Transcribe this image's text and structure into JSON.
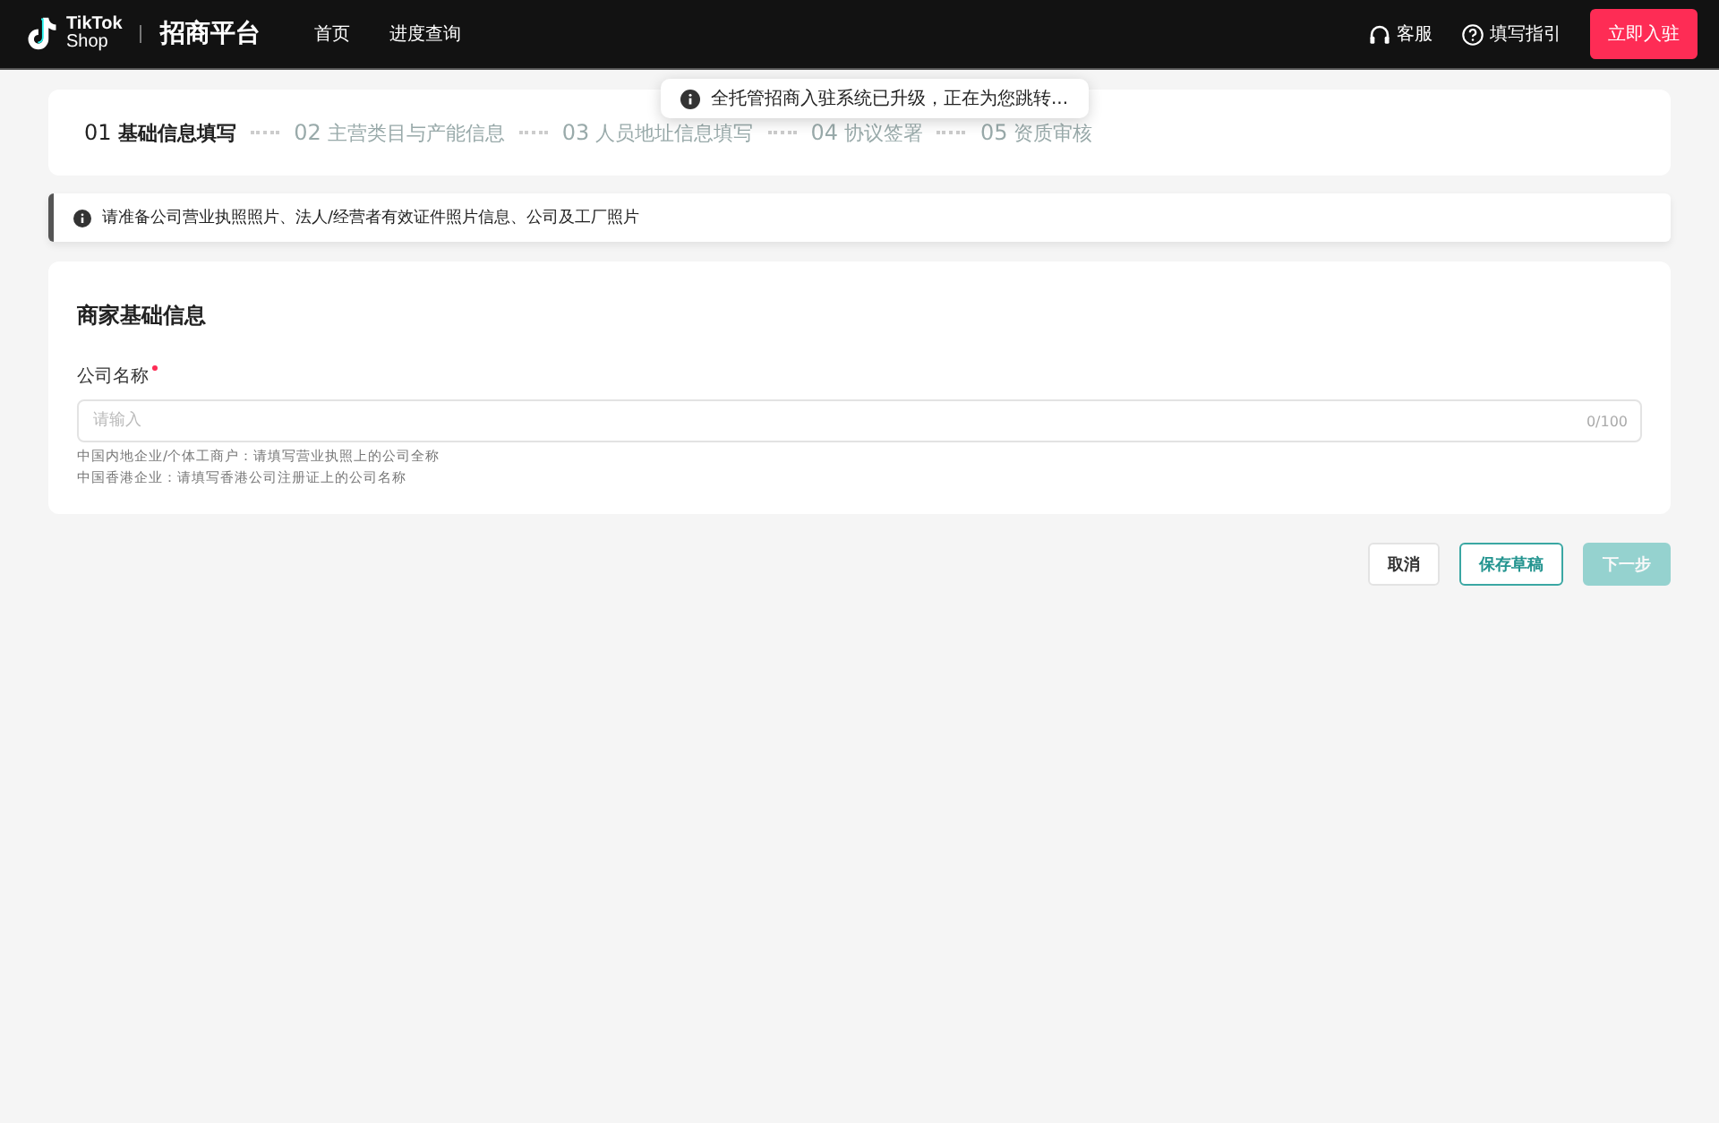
{
  "header": {
    "logo_line1": "TikTok",
    "logo_line2": "Shop",
    "platform": "招商平台",
    "nav": [
      {
        "label": "首页"
      },
      {
        "label": "进度查询"
      }
    ],
    "links": [
      {
        "kind": "support",
        "label": "客服"
      },
      {
        "kind": "help",
        "label": "填写指引"
      }
    ],
    "cta": "立即入驻"
  },
  "steps": [
    {
      "number": "01",
      "label": "基础信息填写",
      "selected": true
    },
    {
      "number": "02",
      "label": "主营类目与产能信息",
      "selected": false
    },
    {
      "number": "03",
      "label": "人员地址信息填写",
      "selected": false
    },
    {
      "number": "04",
      "label": "协议签署",
      "selected": false
    },
    {
      "number": "05",
      "label": "资质审核",
      "selected": false
    }
  ],
  "toast": "全托管招商入驻系统已升级，正在为您跳转...",
  "notice": "请准备公司营业执照照片、法人/经营者有效证件照片信息、公司及工厂照片",
  "form": {
    "title": "商家基础信息",
    "field": {
      "label": "公司名称",
      "required": true,
      "placeholder": "请输入",
      "counter": "0/100",
      "hints": [
        "中国内地企业/个体工商户：请填写营业执照上的公司全称",
        "中国香港企业：请填写香港公司注册证上的公司名称"
      ]
    }
  },
  "buttons": [
    {
      "kind": "plain",
      "label": "取消",
      "disabled": false
    },
    {
      "kind": "outline",
      "label": "保存草稿",
      "disabled": false
    },
    {
      "kind": "primary",
      "label": "下一步",
      "disabled": true
    }
  ]
}
